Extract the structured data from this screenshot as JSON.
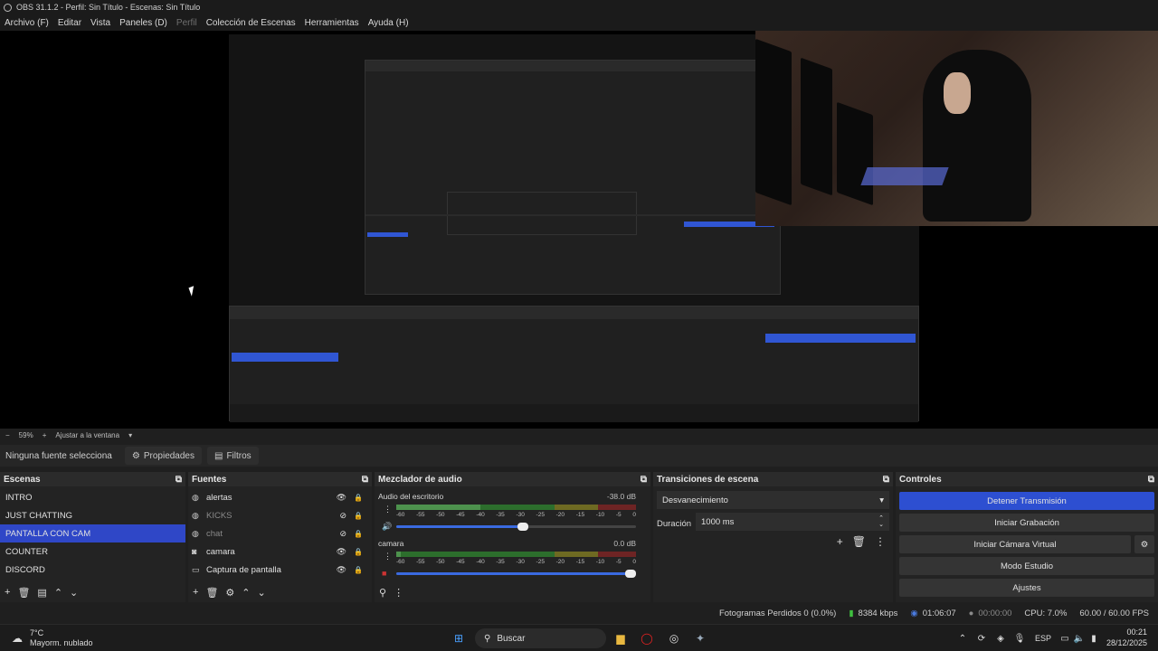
{
  "titlebar": {
    "title": "OBS 31.1.2 - Perfil: Sin Título - Escenas: Sin Título"
  },
  "menu": {
    "archivo": "Archivo (F)",
    "editar": "Editar",
    "vista": "Vista",
    "paneles": "Paneles (D)",
    "perfil": "Perfil",
    "coleccion": "Colección de Escenas",
    "herramientas": "Herramientas",
    "ayuda": "Ayuda (H)"
  },
  "zoombar": {
    "minus": "−",
    "zoom": "59%",
    "plus": "+",
    "fit": "Ajustar a la ventana"
  },
  "sourcebar": {
    "no_source": "Ninguna fuente selecciona",
    "properties": "Propiedades",
    "filters": "Filtros"
  },
  "scenes": {
    "title": "Escenas",
    "items": [
      "INTRO",
      "JUST CHATTING",
      "PANTALLA CON CAM",
      "COUNTER",
      "DISCORD"
    ],
    "active_index": 2
  },
  "sources": {
    "title": "Fuentes",
    "items": [
      {
        "name": "alertas",
        "visible": true,
        "icon": "globe-icon"
      },
      {
        "name": "KICKS",
        "visible": false,
        "icon": "globe-icon"
      },
      {
        "name": "chat",
        "visible": false,
        "icon": "globe-icon"
      },
      {
        "name": "camara",
        "visible": true,
        "icon": "camera-icon"
      },
      {
        "name": "Captura de pantalla",
        "visible": true,
        "icon": "monitor-icon"
      }
    ]
  },
  "mixer": {
    "title": "Mezclador de audio",
    "scale": [
      "-60",
      "-55",
      "-50",
      "-45",
      "-40",
      "-35",
      "-30",
      "-25",
      "-20",
      "-15",
      "-10",
      "-5",
      "0"
    ],
    "channels": [
      {
        "name": "Audio del escritorio",
        "db": "-38.0 dB",
        "level": 0.35,
        "volume": 0.55
      },
      {
        "name": "camara",
        "db": "0.0 dB",
        "level": 0.02,
        "volume": 1.0
      }
    ]
  },
  "transitions": {
    "title": "Transiciones de escena",
    "selected": "Desvanecimiento",
    "duration_label": "Duración",
    "duration_value": "1000 ms"
  },
  "controls": {
    "title": "Controles",
    "stop_stream": "Detener Transmisión",
    "start_record": "Iniciar Grabación",
    "start_vcam": "Iniciar Cámara Virtual",
    "studio_mode": "Modo Estudio",
    "settings": "Ajustes"
  },
  "status": {
    "dropped": "Fotogramas Perdidos 0 (0.0%)",
    "kbps": "8384 kbps",
    "stream_time": "01:06:07",
    "rec_time": "00:00:00",
    "cpu": "CPU: 7.0%",
    "fps": "60.00 / 60.00 FPS"
  },
  "taskbar": {
    "weather_temp": "7°C",
    "weather_desc": "Mayorm. nublado",
    "search": "Buscar",
    "lang": "ESP",
    "time": "00:21",
    "date": "28/12/2025"
  },
  "colors": {
    "accent": "#2d4fd1",
    "bg": "#1f1f1f",
    "dock": "#232323"
  }
}
